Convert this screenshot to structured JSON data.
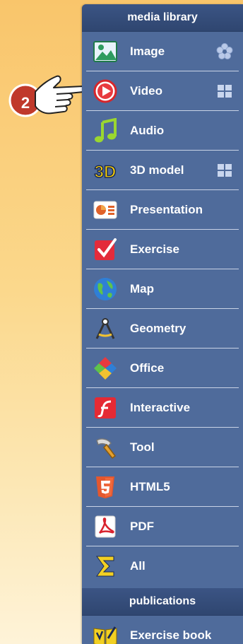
{
  "sections": {
    "media_library": "media library",
    "publications": "publications"
  },
  "items": [
    {
      "label": "Image",
      "icon": "image-icon",
      "extra": "flower-icon"
    },
    {
      "label": "Video",
      "icon": "video-play-icon",
      "extra": "grid-icon"
    },
    {
      "label": "Audio",
      "icon": "music-note-icon"
    },
    {
      "label": "3D model",
      "icon": "3d-icon",
      "extra": "grid-icon"
    },
    {
      "label": "Presentation",
      "icon": "presentation-icon"
    },
    {
      "label": "Exercise",
      "icon": "exercise-check-icon"
    },
    {
      "label": "Map",
      "icon": "globe-icon"
    },
    {
      "label": "Geometry",
      "icon": "compass-icon"
    },
    {
      "label": "Office",
      "icon": "office-diamond-icon"
    },
    {
      "label": "Interactive",
      "icon": "flash-icon"
    },
    {
      "label": "Tool",
      "icon": "hammer-icon"
    },
    {
      "label": "HTML5",
      "icon": "html5-icon"
    },
    {
      "label": "PDF",
      "icon": "pdf-icon"
    },
    {
      "label": "All",
      "icon": "sigma-icon"
    }
  ],
  "publications": [
    {
      "label": "Exercise book",
      "icon": "exercise-book-icon"
    }
  ],
  "callout": {
    "number": "2"
  },
  "colors": {
    "panel": "#4f6b9b",
    "header": "#2f4670",
    "separator": "#c9d3e6",
    "callout": "#c0392b"
  }
}
